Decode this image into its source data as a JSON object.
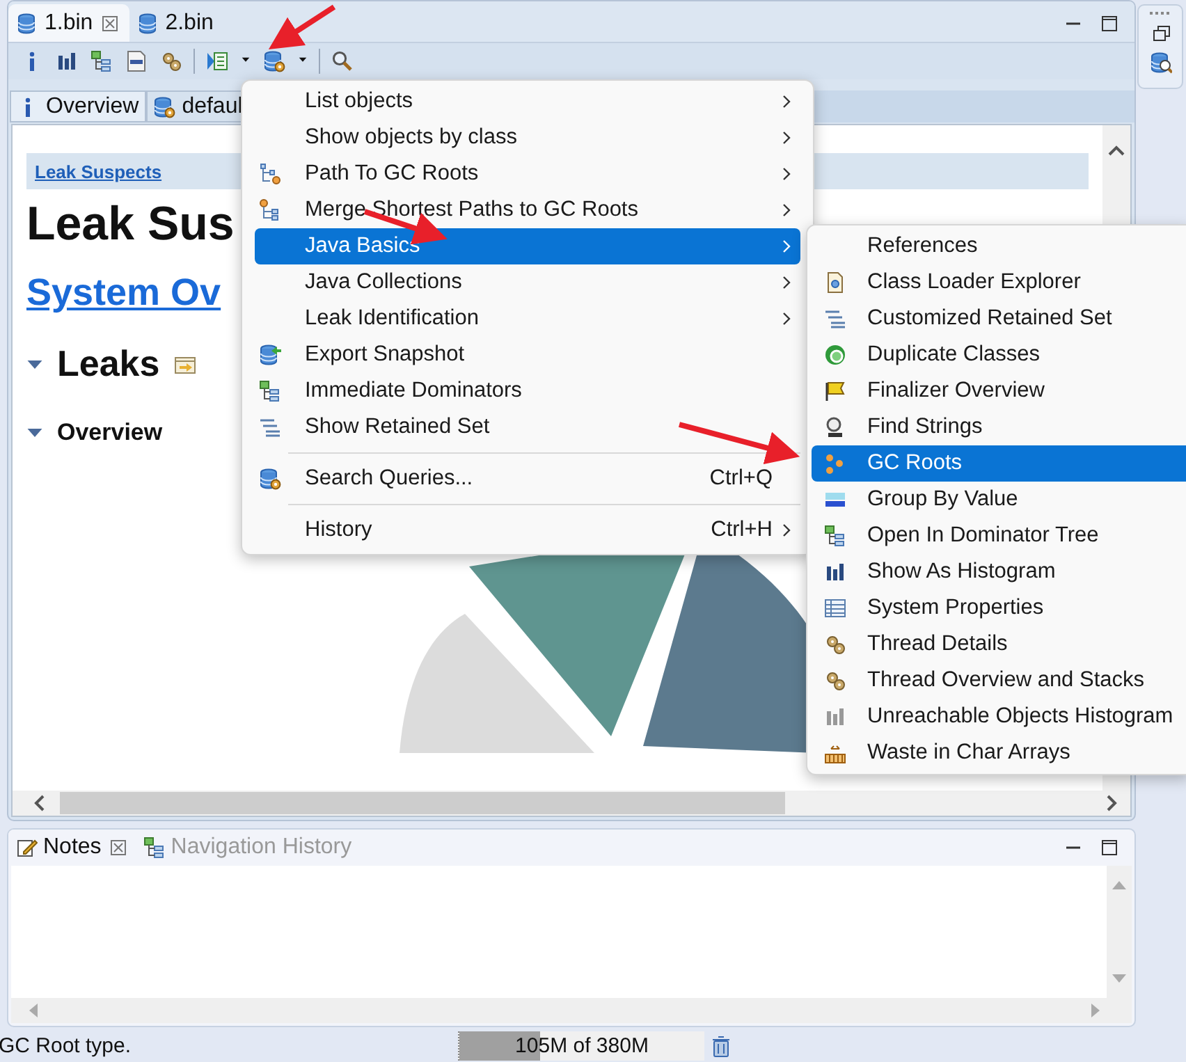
{
  "editor_tabs": [
    {
      "label": "1.bin",
      "selected": true,
      "closable": true
    },
    {
      "label": "2.bin",
      "selected": false,
      "closable": false
    }
  ],
  "view_tabs": [
    {
      "label": "Overview",
      "selected": true
    },
    {
      "label": "defaul",
      "selected": false
    }
  ],
  "report": {
    "breadcrumb": "Leak Suspects",
    "title": "Leak Sus",
    "link": "System Ov",
    "sections": [
      {
        "kind": "major",
        "label": "Leaks",
        "expanded": true
      },
      {
        "kind": "minor",
        "label": "Overview",
        "expanded": true
      }
    ]
  },
  "menu": {
    "items": [
      {
        "kind": "item",
        "label": "List objects",
        "submenu": true,
        "selected": false
      },
      {
        "kind": "item",
        "label": "Show objects by class",
        "submenu": true,
        "selected": false
      },
      {
        "kind": "item",
        "label": "Path To GC Roots",
        "submenu": true,
        "selected": false
      },
      {
        "kind": "item",
        "label": "Merge Shortest Paths to GC Roots",
        "submenu": true,
        "selected": false
      },
      {
        "kind": "item",
        "label": "Java Basics",
        "submenu": true,
        "selected": true
      },
      {
        "kind": "item",
        "label": "Java Collections",
        "submenu": true,
        "selected": false
      },
      {
        "kind": "item",
        "label": "Leak Identification",
        "submenu": true,
        "selected": false
      },
      {
        "kind": "item",
        "label": "Export Snapshot",
        "submenu": false,
        "selected": false
      },
      {
        "kind": "item",
        "label": "Immediate Dominators",
        "submenu": false,
        "selected": false
      },
      {
        "kind": "item",
        "label": "Show Retained Set",
        "submenu": false,
        "selected": false
      },
      {
        "kind": "separator"
      },
      {
        "kind": "item",
        "label": "Search Queries...",
        "shortcut": "Ctrl+Q",
        "submenu": false,
        "selected": false
      },
      {
        "kind": "separator"
      },
      {
        "kind": "item",
        "label": "History",
        "shortcut": "Ctrl+H",
        "submenu": true,
        "selected": false
      }
    ]
  },
  "submenu": {
    "items": [
      {
        "label": "References",
        "selected": false
      },
      {
        "label": "Class Loader Explorer",
        "selected": false
      },
      {
        "label": "Customized Retained Set",
        "selected": false
      },
      {
        "label": "Duplicate Classes",
        "selected": false
      },
      {
        "label": "Finalizer Overview",
        "selected": false
      },
      {
        "label": "Find Strings",
        "selected": false
      },
      {
        "label": "GC Roots",
        "selected": true
      },
      {
        "label": "Group By Value",
        "selected": false
      },
      {
        "label": "Open In Dominator Tree",
        "selected": false
      },
      {
        "label": "Show As Histogram",
        "selected": false
      },
      {
        "label": "System Properties",
        "selected": false
      },
      {
        "label": "Thread Details",
        "selected": false
      },
      {
        "label": "Thread Overview and Stacks",
        "selected": false
      },
      {
        "label": "Unreachable Objects Histogram",
        "selected": false
      },
      {
        "label": "Waste in Char Arrays",
        "selected": false
      }
    ]
  },
  "bottom_tabs": [
    {
      "label": "Notes",
      "selected": true,
      "closable": true
    },
    {
      "label": "Navigation History",
      "selected": false,
      "closable": false
    }
  ],
  "status_bar": {
    "message": "GC Root type.",
    "memory": {
      "text": "105M of 380M",
      "level": 0.33
    }
  }
}
